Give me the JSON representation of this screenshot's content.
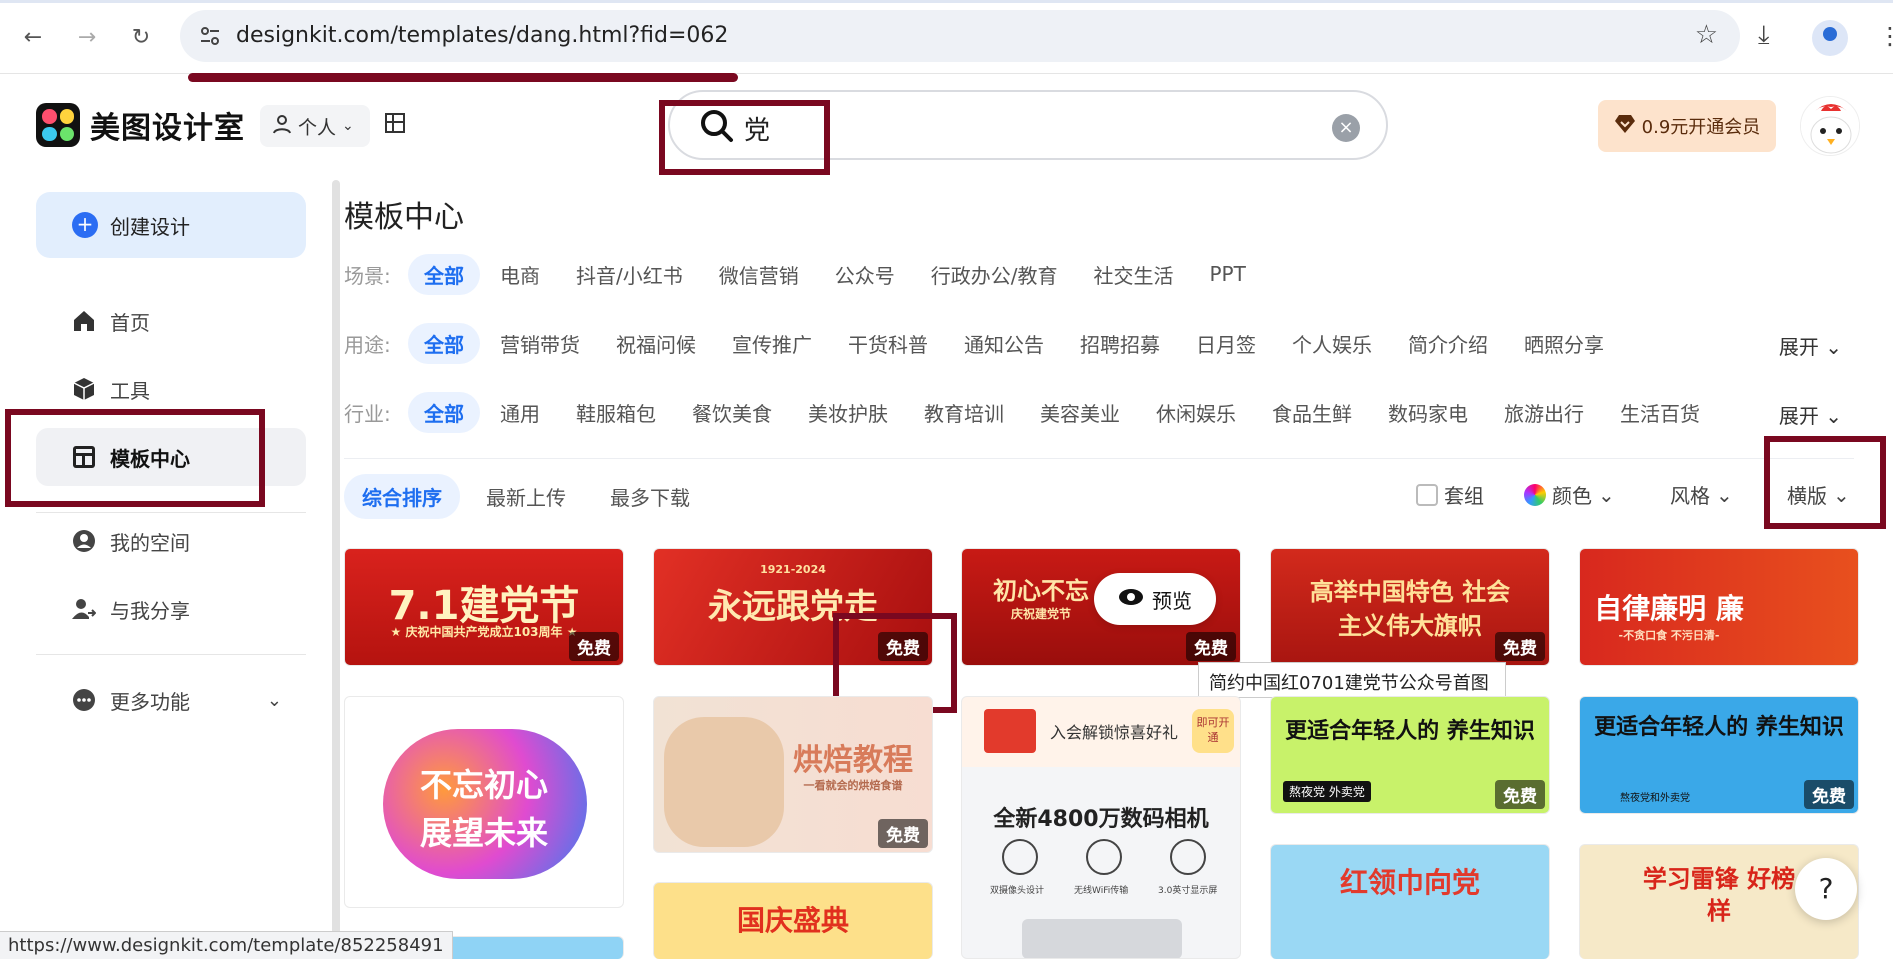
{
  "browser": {
    "url": "designkit.com/templates/dang.html?fid=062",
    "status_url": "https://www.designkit.com/template/852258491"
  },
  "header": {
    "app_name": "美图设计室",
    "account_label": "个人",
    "search_value": "党",
    "vip_label": "0.9元开通会员"
  },
  "sidebar": {
    "create_label": "创建设计",
    "items": [
      {
        "label": "首页",
        "icon": "home-icon"
      },
      {
        "label": "工具",
        "icon": "box-icon"
      },
      {
        "label": "模板中心",
        "icon": "template-icon"
      },
      {
        "label": "我的空间",
        "icon": "user-circle-icon"
      },
      {
        "label": "与我分享",
        "icon": "share-user-icon"
      },
      {
        "label": "更多功能",
        "icon": "more-icon"
      }
    ]
  },
  "main": {
    "title": "模板中心",
    "scene": {
      "label": "场景:",
      "options": [
        "全部",
        "电商",
        "抖音/小红书",
        "微信营销",
        "公众号",
        "行政办公/教育",
        "社交生活",
        "PPT"
      ]
    },
    "usage": {
      "label": "用途:",
      "options": [
        "全部",
        "营销带货",
        "祝福问候",
        "宣传推广",
        "干货科普",
        "通知公告",
        "招聘招募",
        "日月签",
        "个人娱乐",
        "简介介绍",
        "晒照分享"
      ],
      "expand": "展开"
    },
    "industry": {
      "label": "行业:",
      "options": [
        "全部",
        "通用",
        "鞋服箱包",
        "餐饮美食",
        "美妆护肤",
        "教育培训",
        "美容美业",
        "休闲娱乐",
        "食品生鲜",
        "数码家电",
        "旅游出行",
        "生活百货"
      ],
      "expand": "展开"
    },
    "sort": [
      "综合排序",
      "最新上传",
      "最多下载"
    ],
    "filters": {
      "set": "套组",
      "color": "颜色",
      "style": "风格",
      "orientation": "横版"
    },
    "free_badge": "免费",
    "preview_label": "预览",
    "tooltip": "简约中国红0701建党节公众号首图",
    "cards": [
      {
        "text": "7.1建党节",
        "sub": "★ 庆祝中国共产党成立103周年 ★"
      },
      {
        "text": "永远跟党走",
        "sub": "1921-2024"
      },
      {
        "text": "初心不忘",
        "sub": "庆祝建党节"
      },
      {
        "text": "高举中国特色 社会主义伟大旗帜",
        "sub": ""
      },
      {
        "text": "自律廉明 廉",
        "sub": "-不贪口食 不污日清-"
      },
      {
        "text": "不忘初心 展望未来",
        "sub": ""
      },
      {
        "text": "烘焙教程",
        "sub": "一看就会的烘焙食谱"
      },
      {
        "text": "全新4800万数码相机",
        "sub": "入会解锁惊喜好礼"
      },
      {
        "text": "更适合年轻人的 养生知识",
        "sub": "熬夜党 外卖党"
      },
      {
        "text": "更适合年轻人的 养生知识",
        "sub": "熬夜党和外卖党"
      },
      {
        "text": "国庆盛典",
        "sub": ""
      },
      {
        "text": "红领巾向党",
        "sub": ""
      },
      {
        "text": "学习雷锋 好榜样",
        "sub": ""
      }
    ],
    "camera_features": [
      "双摄像头设计",
      "无线WiFi传输",
      "3.0英寸显示屏"
    ],
    "camera_badge": "即可开通"
  }
}
